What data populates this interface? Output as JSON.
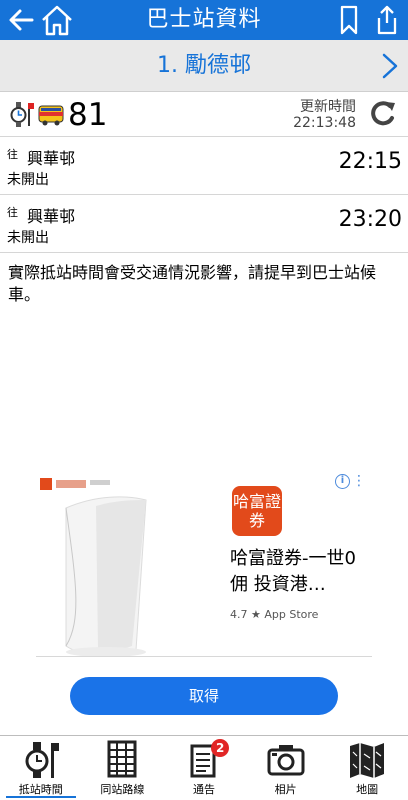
{
  "header": {
    "title": "巴士站資料"
  },
  "stop": {
    "name": "1. 勵德邨"
  },
  "route": {
    "number": "81",
    "updated_label": "更新時間",
    "updated_time": "22:13:48"
  },
  "etas": [
    {
      "to_label": "往",
      "destination": "興華邨",
      "status": "未開出",
      "time": "22:15"
    },
    {
      "to_label": "往",
      "destination": "興華邨",
      "status": "未開出",
      "time": "23:20"
    }
  ],
  "notice": "實際抵站時間會受交通情況影響，請提早到巴士站候車。",
  "ad": {
    "logo_text": "哈富證券",
    "headline": "哈富證券-一世0佣 投資港…",
    "rating": "4.7",
    "store": "App Store",
    "cta_label": "取得",
    "info_icon": "i",
    "more_icon": "⋮"
  },
  "tabs": [
    {
      "label": "抵站時間",
      "icon": "bus-stop-clock-icon"
    },
    {
      "label": "同站路線",
      "icon": "timetable-icon"
    },
    {
      "label": "通告",
      "icon": "notice-icon",
      "badge": "2"
    },
    {
      "label": "相片",
      "icon": "camera-icon"
    },
    {
      "label": "地圖",
      "icon": "map-icon"
    }
  ],
  "colors": {
    "primary": "#1673d8",
    "cta": "#1a73e8",
    "badge": "#e12626",
    "ad_logo": "#e24a1b"
  }
}
